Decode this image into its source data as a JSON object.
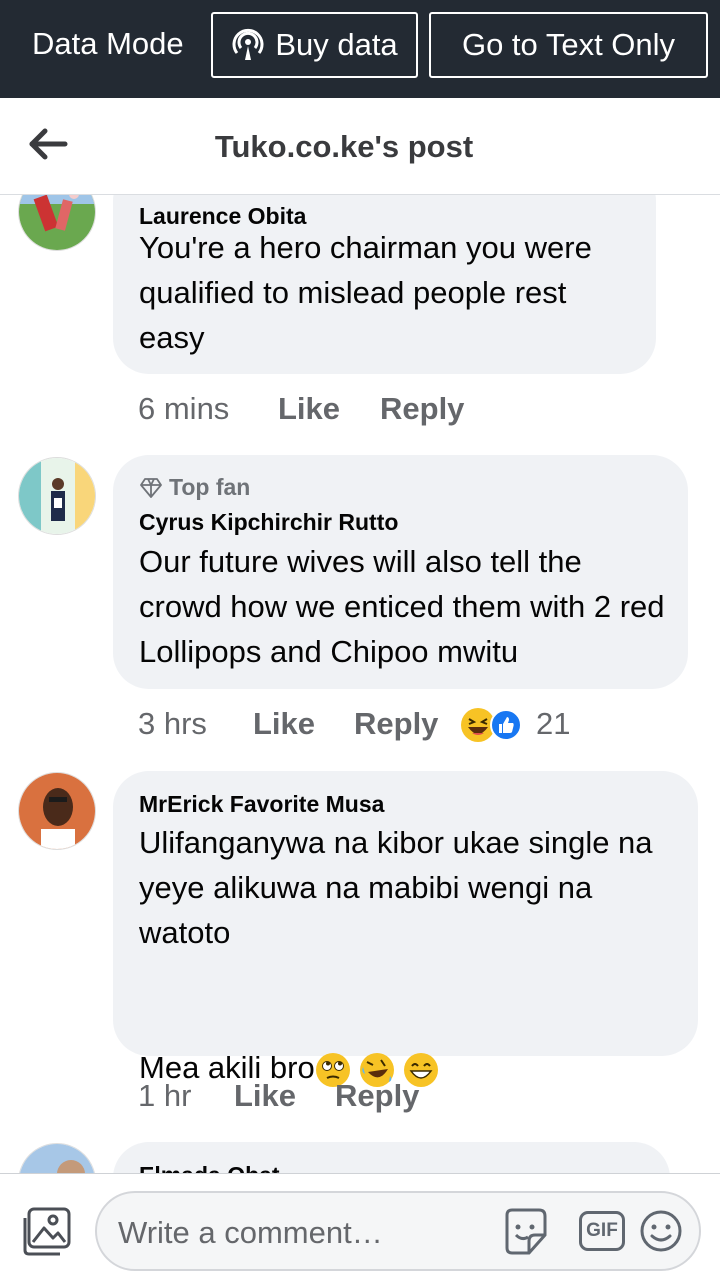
{
  "topbar": {
    "data_mode": "Data Mode",
    "buy_data": "Buy data",
    "text_only": "Go to Text Only"
  },
  "header": {
    "title": "Tuko.co.ke's post"
  },
  "comments": [
    {
      "author": "Laurence Obita",
      "text": "You're a hero chairman you were qualified to mislead people rest easy",
      "time": "6 mins",
      "like": "Like",
      "reply": "Reply"
    },
    {
      "badge": "Top fan",
      "author": "Cyrus Kipchirchir Rutto",
      "text": "Our future wives will also tell the crowd how we enticed them with 2 red Lollipops and Chipoo mwitu",
      "time": "3 hrs",
      "like": "Like",
      "reply": "Reply",
      "reaction_count": "21"
    },
    {
      "author": "MrErick Favorite Musa",
      "text": "Ulifanganywa na kibor ukae single na yeye alikuwa na mabibi wengi na watoto",
      "text2": "Mea akili bro",
      "time": "1 hr",
      "like": "Like",
      "reply": "Reply"
    },
    {
      "author": "Elmada Obat"
    }
  ],
  "composer": {
    "placeholder": "Write a comment…",
    "gif_label": "GIF"
  },
  "colors": {
    "topbar_bg": "#232a33",
    "bubble_bg": "#f0f2f5",
    "meta_text": "#65676b"
  }
}
